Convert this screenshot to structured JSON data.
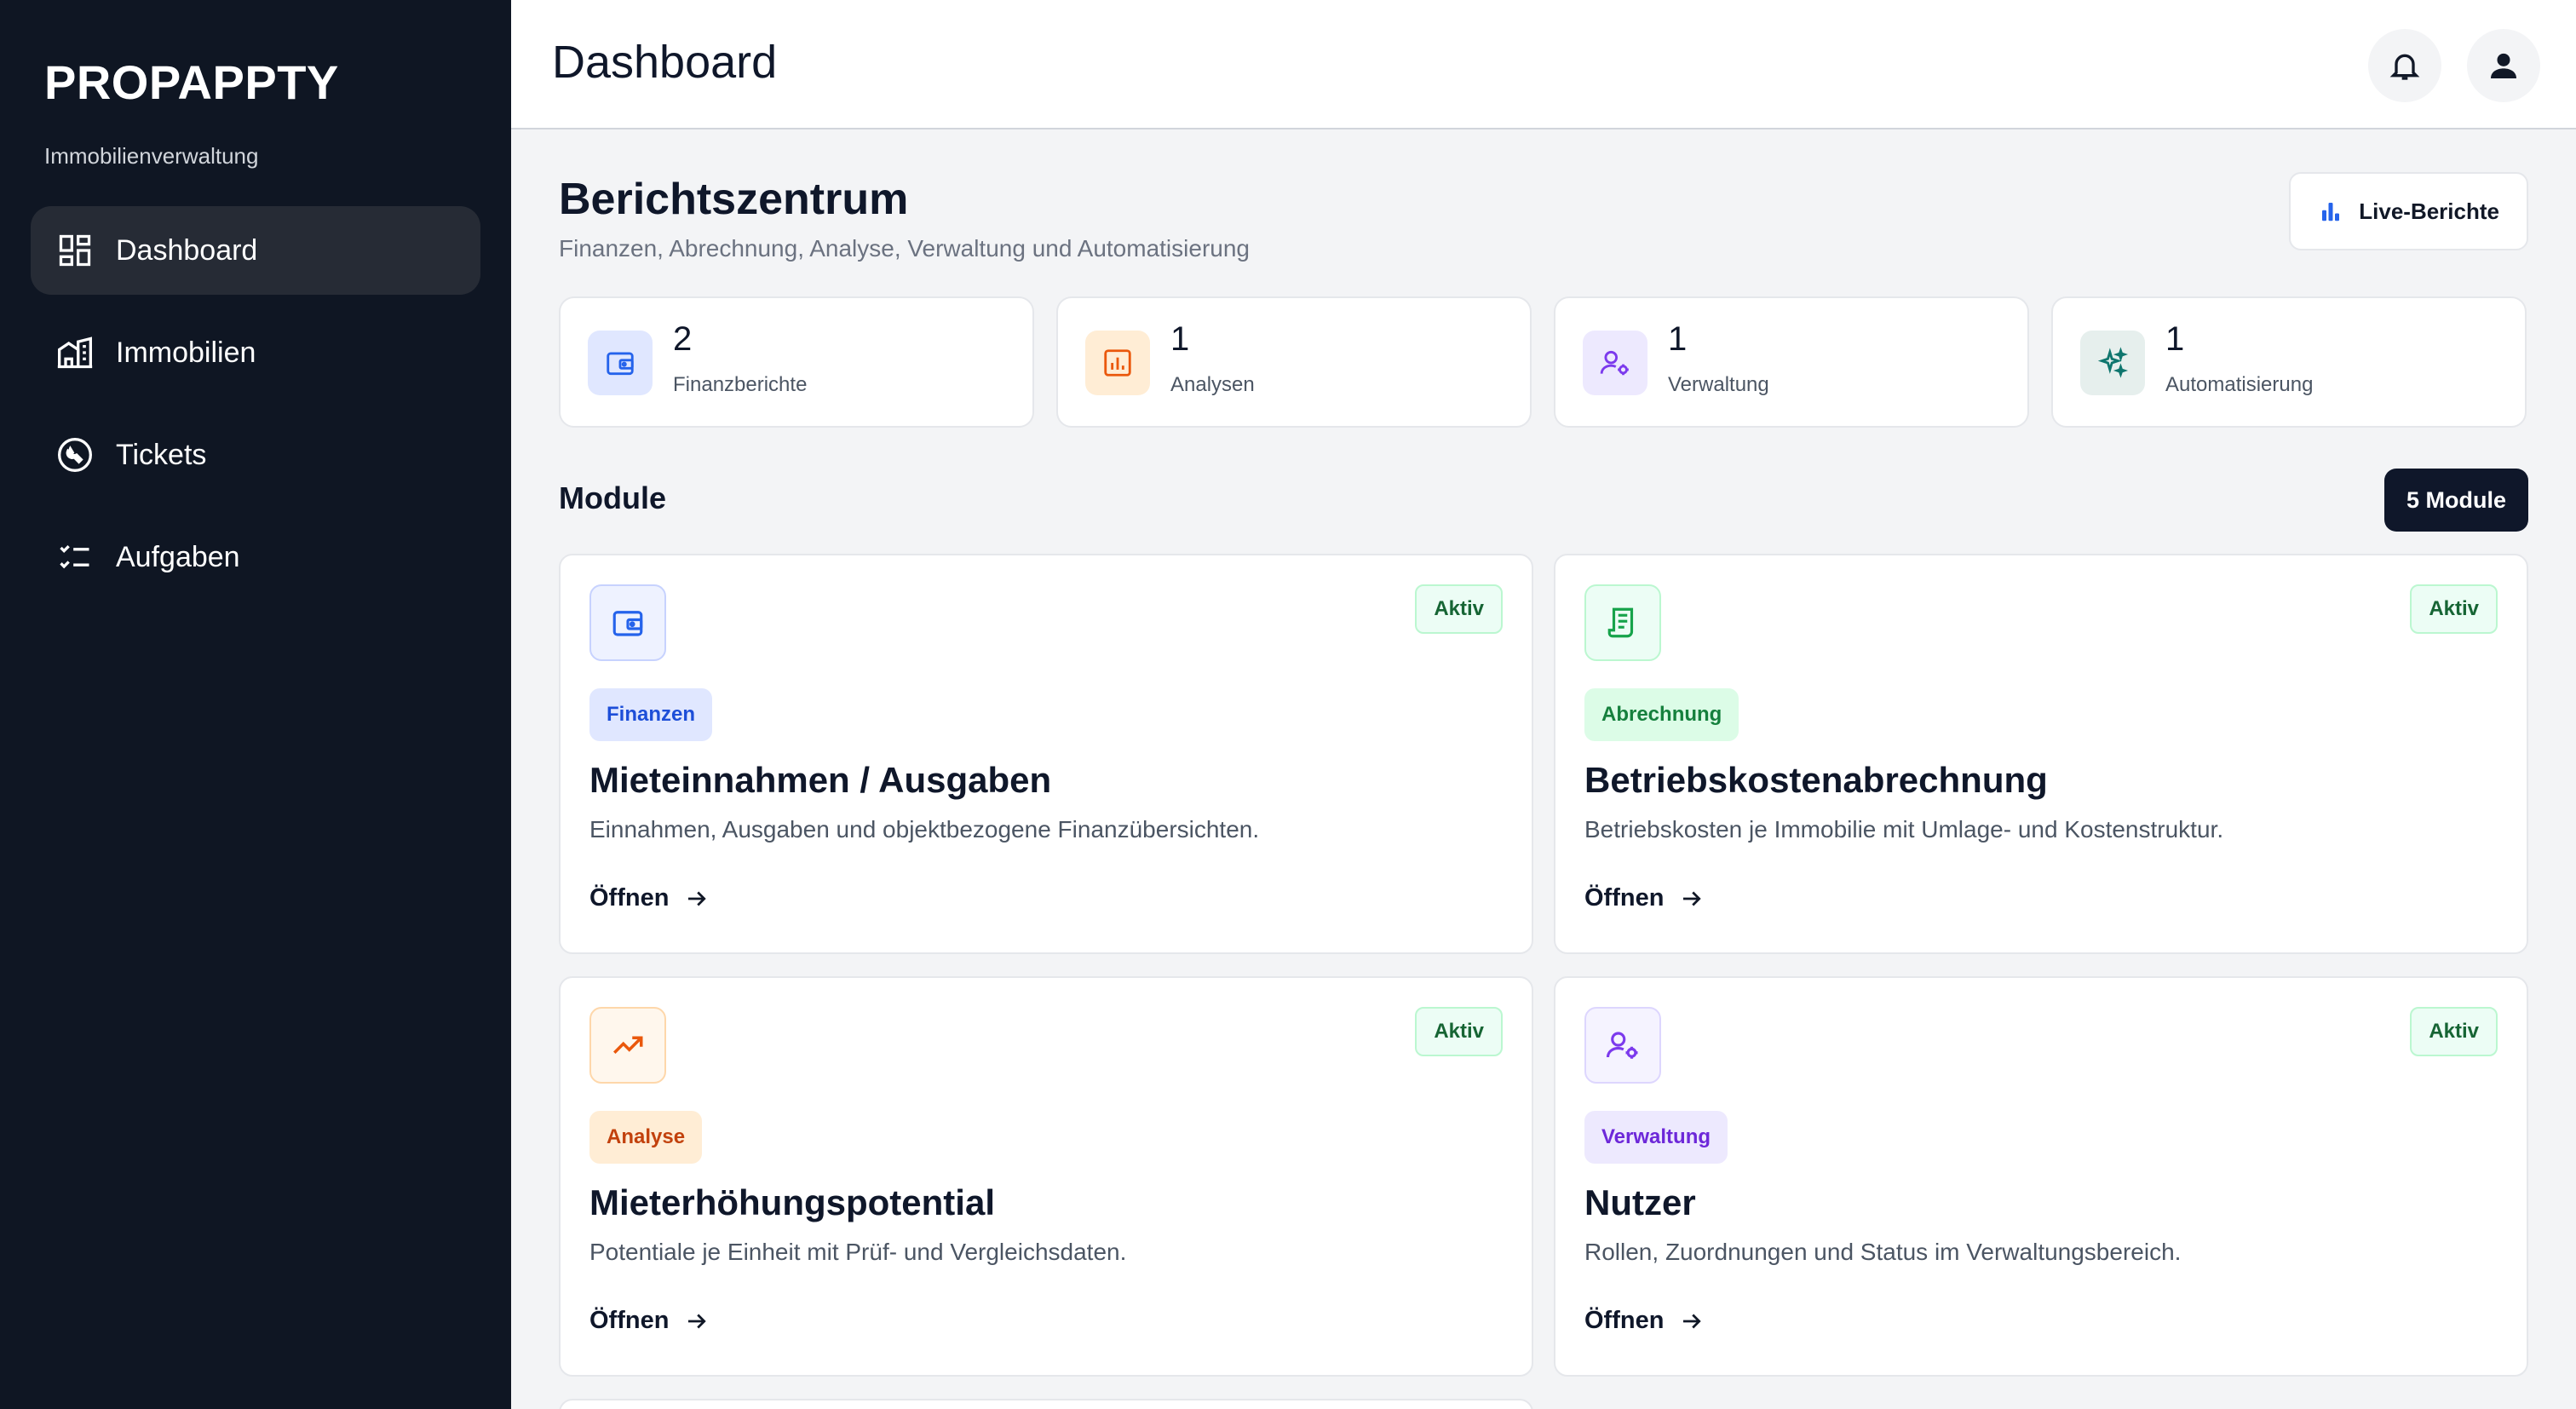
{
  "brand": {
    "name": "PROPAPPTY",
    "subtitle": "Immobilienverwaltung"
  },
  "nav": [
    {
      "label": "Dashboard",
      "icon": "dashboard-icon",
      "active": true
    },
    {
      "label": "Immobilien",
      "icon": "building-icon",
      "active": false
    },
    {
      "label": "Tickets",
      "icon": "wrench-icon",
      "active": false
    },
    {
      "label": "Aufgaben",
      "icon": "checklist-icon",
      "active": false
    }
  ],
  "header": {
    "title": "Dashboard",
    "notification_icon": "bell-icon",
    "user_icon": "user-icon"
  },
  "section": {
    "title": "Berichtszentrum",
    "subtitle": "Finanzen, Abrechnung, Analyse, Verwaltung und Automatisierung",
    "live_button": "Live-Berichte"
  },
  "stats": [
    {
      "value": "2",
      "label": "Finanzberichte",
      "icon": "wallet-icon",
      "color": "#2563eb"
    },
    {
      "value": "1",
      "label": "Analysen",
      "icon": "report-icon",
      "color": "#ea580c"
    },
    {
      "value": "1",
      "label": "Verwaltung",
      "icon": "user-gear-icon",
      "color": "#7c3aed"
    },
    {
      "value": "1",
      "label": "Automatisierung",
      "icon": "sparkles-icon",
      "color": "#0f766e"
    }
  ],
  "modules": {
    "title": "Module",
    "count_label": "5 Module",
    "items": [
      {
        "tag": "Finanzen",
        "status": "Aktiv",
        "title": "Mieteinnahmen / Ausgaben",
        "description": "Einnahmen, Ausgaben und objektbezogene Finanzübersichten.",
        "action": "Öffnen",
        "icon": "wallet-icon",
        "color": "#2563eb"
      },
      {
        "tag": "Abrechnung",
        "status": "Aktiv",
        "title": "Betriebskostenabrechnung",
        "description": "Betriebskosten je Immobilie mit Umlage- und Kostenstruktur.",
        "action": "Öffnen",
        "icon": "receipt-icon",
        "color": "#16a34a"
      },
      {
        "tag": "Analyse",
        "status": "Aktiv",
        "title": "Mieterhöhungspotential",
        "description": "Potentiale je Einheit mit Prüf- und Vergleichsdaten.",
        "action": "Öffnen",
        "icon": "trend-up-icon",
        "color": "#ea580c"
      },
      {
        "tag": "Verwaltung",
        "status": "Aktiv",
        "title": "Nutzer",
        "description": "Rollen, Zuordnungen und Status im Verwaltungsbereich.",
        "action": "Öffnen",
        "icon": "user-gear-icon",
        "color": "#7c3aed"
      }
    ]
  }
}
